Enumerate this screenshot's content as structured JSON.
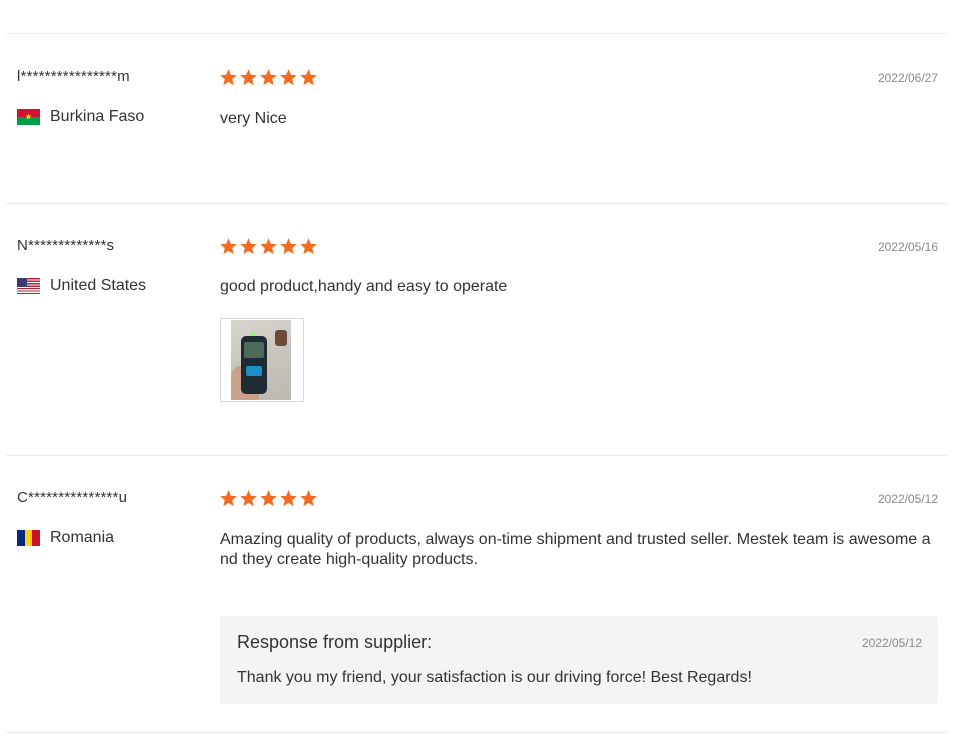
{
  "colors": {
    "star": "#f56a1f",
    "date": "#888888",
    "divider": "#ececec",
    "reply_bg": "#f4f4f4"
  },
  "reviews": [
    {
      "user": "l****************m",
      "country": "Burkina Faso",
      "flag": "burkina-faso-flag-icon",
      "rating": 5,
      "date": "2022/06/27",
      "text": "very Nice"
    },
    {
      "user": "N*************s",
      "country": "United States",
      "flag": "united-states-flag-icon",
      "rating": 5,
      "date": "2022/05/16",
      "text": "good product,handy and easy to operate",
      "photo": "review-photo-laser-distance-meter"
    },
    {
      "user": "C***************u",
      "country": "Romania",
      "flag": "romania-flag-icon",
      "rating": 5,
      "date": "2022/05/12",
      "text": "Amazing quality of products, always on-time shipment and trusted seller. Mestek team is awesome and they create high-quality products.",
      "reply": {
        "title": "Response from supplier:",
        "date": "2022/05/12",
        "text": "Thank you my friend, your satisfaction is our driving force! Best Regards!"
      }
    }
  ]
}
